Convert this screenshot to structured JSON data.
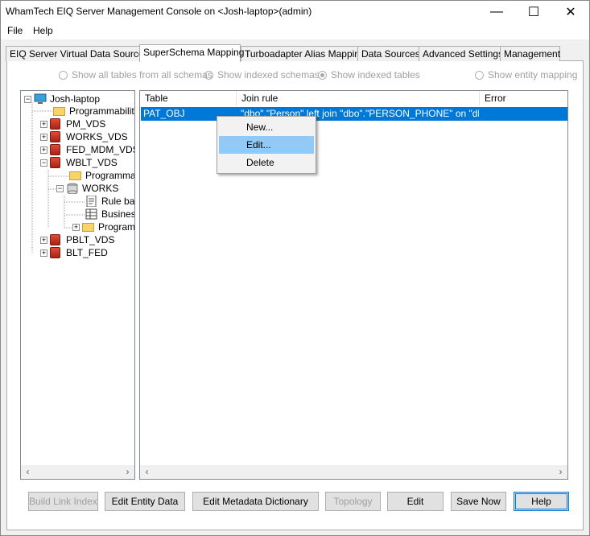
{
  "window": {
    "title": "WhamTech EIQ Server Management Console on <Josh-laptop>(admin)"
  },
  "titlebar_controls": {
    "minimize": "—",
    "maximize": "☐",
    "close": "✕"
  },
  "menu": {
    "file": "File",
    "help": "Help"
  },
  "tabs": [
    {
      "label": "EIQ Server Virtual Data Sources"
    },
    {
      "label": "SuperSchema Mapping"
    },
    {
      "label": "Turboadapter Alias Mapping"
    },
    {
      "label": "Data Sources"
    },
    {
      "label": "Advanced Settings"
    },
    {
      "label": "Management"
    }
  ],
  "options": {
    "show_all_tables": "Show all tables from all schemas",
    "show_indexed_schemas": "Show indexed schemas",
    "show_indexed_tables": "Show indexed tables",
    "show_entity_mapping": "Show entity mapping",
    "selected": "Show indexed tables"
  },
  "tree": {
    "root": "Josh-laptop",
    "items": [
      {
        "label": "Programmability",
        "icon": "folder-icon"
      },
      {
        "label": "PM_VDS",
        "icon": "database-icon"
      },
      {
        "label": "WORKS_VDS",
        "icon": "database-icon"
      },
      {
        "label": "FED_MDM_VDS",
        "icon": "database-icon"
      },
      {
        "label": "WBLT_VDS",
        "icon": "database-icon"
      },
      {
        "label": "Programmability",
        "icon": "folder-icon"
      },
      {
        "label": "WORKS",
        "icon": "server-icon"
      },
      {
        "label": "Rule ba",
        "icon": "document-icon"
      },
      {
        "label": "Busines",
        "icon": "table-icon"
      },
      {
        "label": "Program",
        "icon": "folder-icon"
      },
      {
        "label": "PBLT_VDS",
        "icon": "database-icon"
      },
      {
        "label": "BLT_FED",
        "icon": "database-icon"
      }
    ]
  },
  "table": {
    "headers": {
      "table": "Table",
      "join_rule": "Join rule",
      "error": "Error"
    },
    "rows": [
      {
        "table": "PAT_OBJ",
        "join_rule": "\"dbo\".\"Person\" left join \"dbo\".\"PERSON_PHONE\" on \"dbo...",
        "error": ""
      }
    ]
  },
  "context_menu": {
    "new": "New...",
    "edit": "Edit...",
    "delete": "Delete"
  },
  "buttons": {
    "build_link_index": "Build Link Index",
    "edit_entity_data": "Edit Entity Data",
    "edit_metadata_dictionary": "Edit Metadata Dictionary",
    "topology": "Topology",
    "edit": "Edit",
    "save_now": "Save Now",
    "help": "Help"
  },
  "colors": {
    "selection": "#0078d7",
    "menu_highlight": "#91c9f7",
    "folder": "#f6d46b",
    "database": "#c0392b"
  }
}
